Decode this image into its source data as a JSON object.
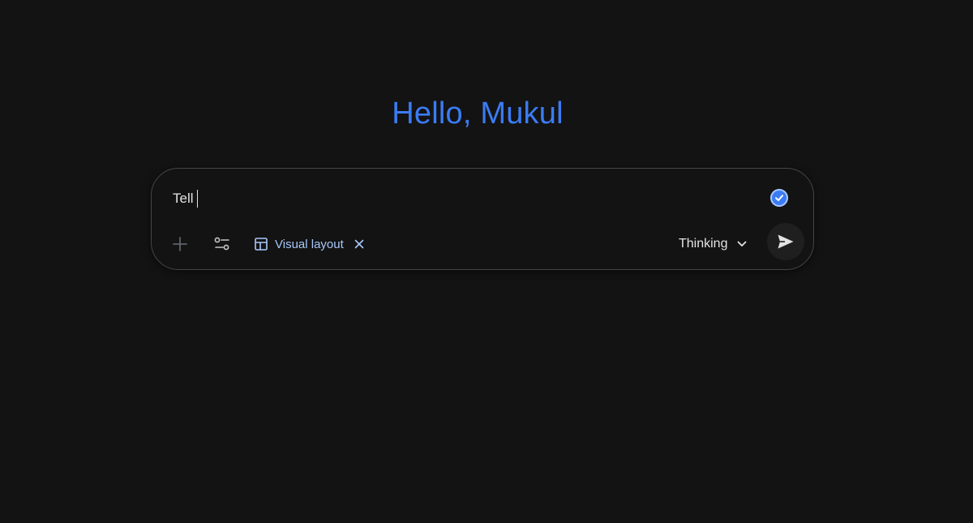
{
  "greeting": "Hello, Mukul",
  "composer": {
    "input_value": "Tell",
    "chip": {
      "label": "Visual layout",
      "icon": "layout-icon",
      "close_icon": "close-icon"
    },
    "model_selector": {
      "label": "Thinking",
      "icon": "chevron-down-icon"
    },
    "buttons": {
      "add": "plus-icon",
      "tools": "tools-icon",
      "send": "send-icon"
    },
    "status_icon": "check-circle-icon"
  },
  "colors": {
    "background": "#131313",
    "accent": "#3b7cf5",
    "chip_text": "#a8c7fa",
    "border": "#444746",
    "text": "#e3e3e3"
  }
}
